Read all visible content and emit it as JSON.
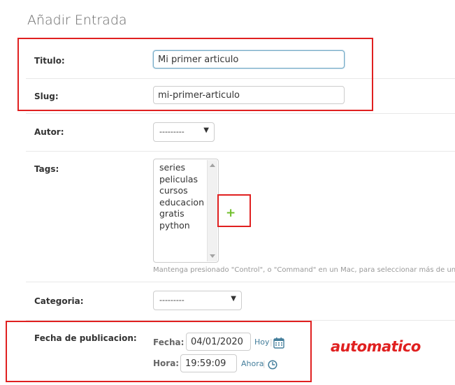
{
  "page": {
    "title": "Añadir Entrada"
  },
  "fields": {
    "titulo": {
      "label": "Titulo:",
      "value": "Mi primer articulo"
    },
    "slug": {
      "label": "Slug:",
      "value": "mi-primer-articulo"
    },
    "autor": {
      "label": "Autor:",
      "selected": "---------"
    },
    "tags": {
      "label": "Tags:",
      "options": [
        "series",
        "peliculas",
        "cursos",
        "educacion",
        "gratis",
        "python"
      ],
      "help": "Mantenga presionado \"Control\", o \"Command\" en un Mac, para seleccionar más de una o"
    },
    "categoria": {
      "label": "Categoria:",
      "selected": "---------"
    },
    "fecha_publicacion": {
      "label": "Fecha de publicacion:",
      "fecha_label": "Fecha:",
      "fecha_value": "04/01/2020",
      "hoy": "Hoy",
      "hora_label": "Hora:",
      "hora_value": "19:59:09",
      "ahora": "Ahora"
    }
  },
  "add_symbol": "+",
  "watermark": "automatico",
  "colors": {
    "annotation": "#e02020",
    "add": "#70bf2b",
    "link": "#447e9b"
  }
}
